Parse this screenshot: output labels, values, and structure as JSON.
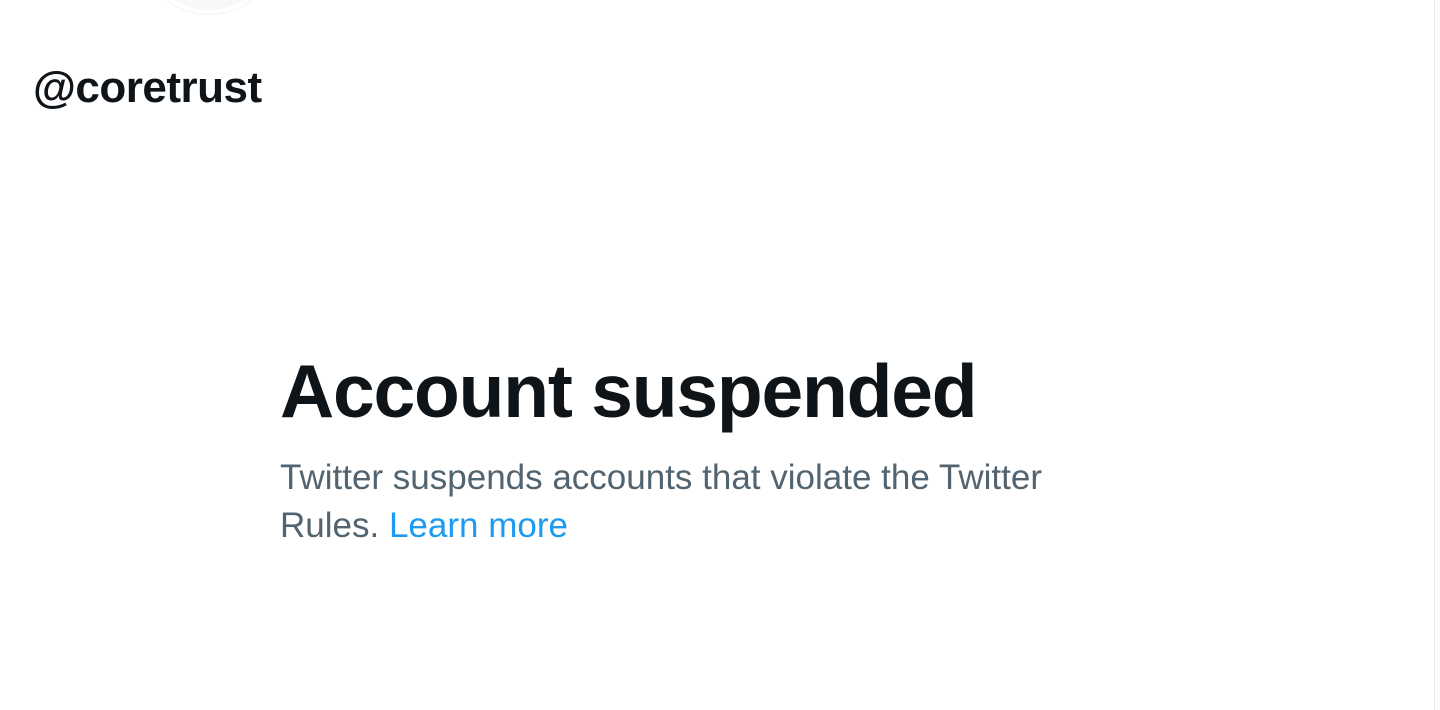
{
  "profile": {
    "handle": "@coretrust"
  },
  "notice": {
    "title": "Account suspended",
    "message_text": "Twitter suspends accounts that violate the Twitter Rules.",
    "learn_more_label": "Learn more"
  },
  "colors": {
    "text_primary": "#0f1419",
    "text_secondary": "#536471",
    "link": "#1d9bf0",
    "background": "#ffffff"
  }
}
